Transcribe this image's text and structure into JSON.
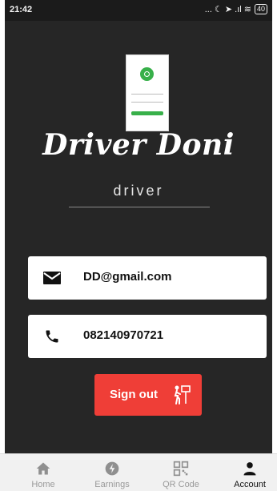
{
  "status_bar": {
    "time": "21:42",
    "indicators": "... ☾ ➤ .ıl ≋",
    "battery": "40"
  },
  "profile": {
    "name": "Driver Doni",
    "role": "driver"
  },
  "contact": {
    "email": "DD@gmail.com",
    "phone": "082140970721"
  },
  "actions": {
    "sign_out_label": "Sign out"
  },
  "bottom_nav": {
    "items": [
      {
        "label": "Home",
        "icon": "home-icon"
      },
      {
        "label": "Earnings",
        "icon": "earnings-icon"
      },
      {
        "label": "QR Code",
        "icon": "qr-code-icon"
      },
      {
        "label": "Account",
        "icon": "account-icon",
        "active": true
      }
    ]
  },
  "colors": {
    "background": "#262626",
    "accent_red": "#ef3e37",
    "brand_green": "#38b04a"
  }
}
